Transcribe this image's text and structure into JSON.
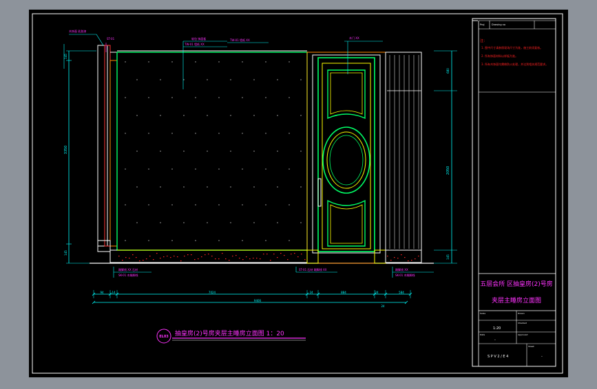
{
  "viewport": {
    "background": "#8d939b",
    "sheet": "#000000"
  },
  "colors": {
    "frame": "#ffffff",
    "wall": "#00ff66",
    "door": "#ffff00",
    "dim": "#00ffff",
    "note": "#ff2222",
    "label": "#ff33ff",
    "red": "#ff0000",
    "orange": "#ff8800"
  },
  "dimensions": {
    "top_row": [
      "94",
      "14",
      "7024",
      "24",
      "884",
      "24",
      "584"
    ],
    "bottom_total": "9400",
    "bottom_right": "24",
    "left_overall": "3350",
    "left_top": "145",
    "left_bottom": "145",
    "right_top": "680",
    "right_mid": "2050",
    "right_bottom": "145",
    "door_mark": "24"
  },
  "annotations": {
    "top_left_1": "木饰面 乳胶漆",
    "top_left_2": "ST-01",
    "top_mid_1": "软包 饰面板",
    "top_mid_2": "TW-01 墙纸 XX",
    "top_door": "木门 XX",
    "bottom_left_1": "踢脚线 XX 石材",
    "bottom_left_2": "SK-01 木踢脚线",
    "bottom_mid": "ST-01 石材 踢脚线 XX",
    "bottom_right_1": "踢脚线 XX",
    "bottom_right_2": "SK-01 木踢脚线"
  },
  "notes": [
    "注：",
    "1. 图中尺寸请参照现场尺寸为准，施工前须复核。",
    "2. 所有饰面材料以样板为准。",
    "3. 所有木饰面均需做防火处理，并达到相关规范要求。"
  ],
  "title_block": {
    "header_1": "Proj",
    "header_2": "Drawing no",
    "project_line_1": "五层会所 区抽皇房(2)号房",
    "project_line_2": "夹层主睡房立面图",
    "scale_label": "Scale",
    "scale_value": "1:20",
    "drawn_label": "Drawn",
    "checked_label": "Checked",
    "approved_label": "Approved",
    "date_label": "Date",
    "dash_1": "-",
    "dash_2": "-",
    "drawing_no": "S P V  2 / E 4",
    "sheet_label": "Sheet"
  },
  "drawing_title": {
    "tag": "EL03",
    "text": "抽皇房(2)号房夹层主睡房立面图  1：20"
  }
}
